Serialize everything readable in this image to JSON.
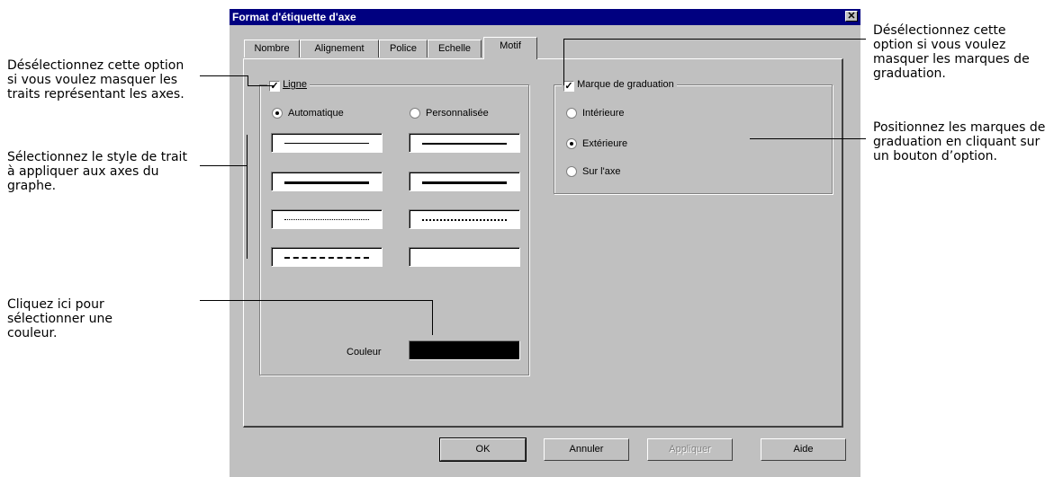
{
  "dialog": {
    "title": "Format d'étiquette d'axe",
    "close_glyph": "✕",
    "tabs": [
      "Nombre",
      "Alignement",
      "Police",
      "Echelle",
      "Motif"
    ],
    "active_tab": "Motif"
  },
  "ligne_group": {
    "label": "Ligne",
    "checked": true,
    "radio_auto": "Automatique",
    "radio_custom": "Personnalisée",
    "selected": "Automatique",
    "color_label": "Couleur",
    "color_value": "#000000",
    "styles": [
      "thin-solid",
      "medium-solid",
      "thick-solid",
      "thick-solid",
      "fine-dotted",
      "dotted",
      "dashed",
      "none"
    ]
  },
  "marque_group": {
    "label": "Marque de graduation",
    "checked": true,
    "options": [
      "Intérieure",
      "Extérieure",
      "Sur l'axe"
    ],
    "selected": "Extérieure"
  },
  "buttons": {
    "ok": "OK",
    "cancel": "Annuler",
    "apply": "Appliquer",
    "help": "Aide"
  },
  "callouts": {
    "left_1": "Désélectionnez cette option si vous voulez masquer les traits représentant les axes.",
    "left_2": "Sélectionnez le style de trait à appliquer aux axes du graphe.",
    "left_3": "Cliquez ici pour sélectionner une couleur.",
    "right_1": "Désélectionnez cette option si vous voulez masquer les marques de graduation.",
    "right_2": "Positionnez les marques de graduation en cliquant sur un bouton d’option."
  }
}
